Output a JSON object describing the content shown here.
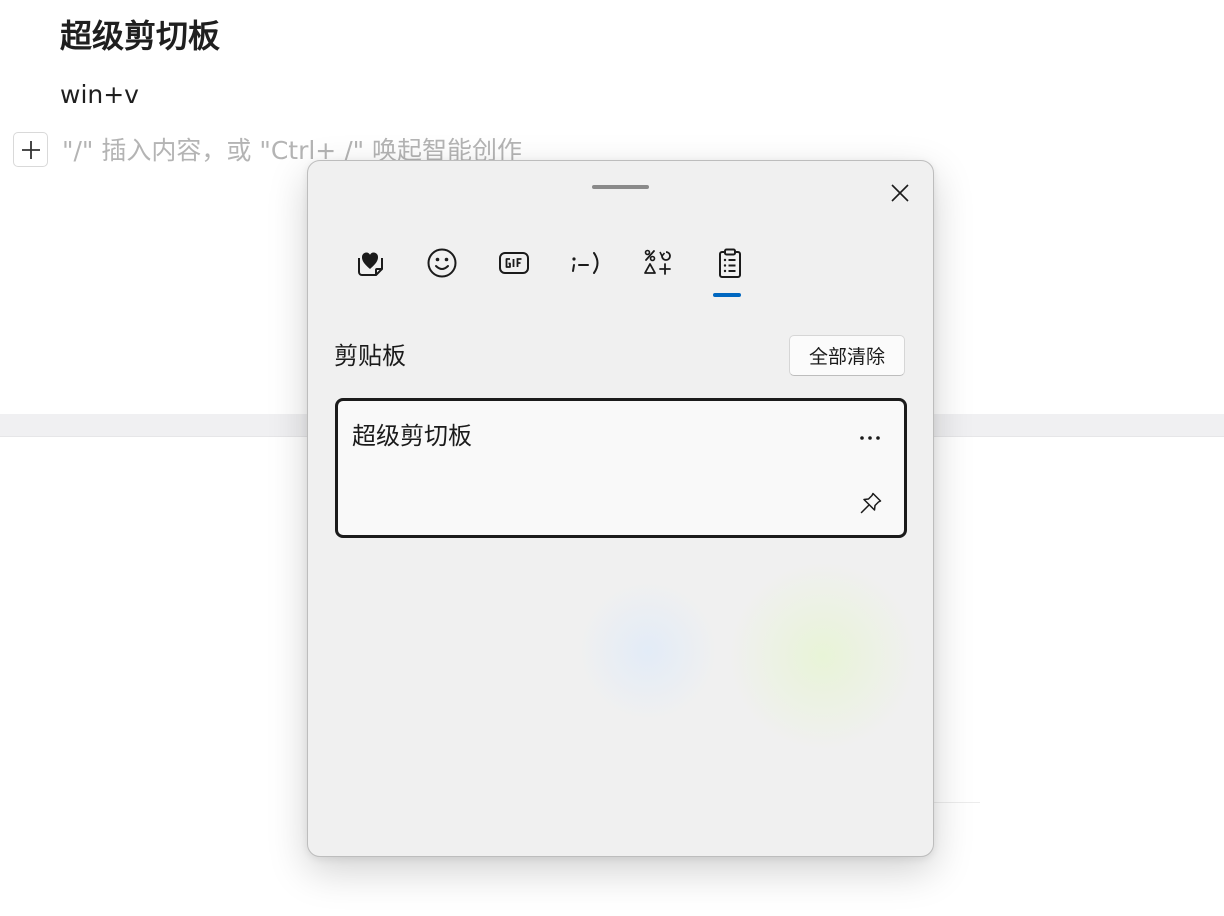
{
  "document": {
    "title": "超级剪切板",
    "line": "win+v",
    "placeholder": "\"/\" 插入内容，或 \"Ctrl+ /\" 唤起智能创作",
    "add_icon": "plus-icon"
  },
  "clipboard_panel": {
    "close_icon": "close-icon",
    "tabs": [
      {
        "icon": "heart-sticker-icon",
        "selected": false
      },
      {
        "icon": "smiley-icon",
        "selected": false
      },
      {
        "icon": "gif-icon",
        "selected": false
      },
      {
        "icon": "kaomoji-icon",
        "label": ";-)",
        "selected": false
      },
      {
        "icon": "symbols-icon",
        "selected": false
      },
      {
        "icon": "clipboard-icon",
        "selected": true
      }
    ],
    "accent_color": "#0067c0",
    "section_title": "剪贴板",
    "clear_all_label": "全部清除",
    "items": [
      {
        "text": "超级剪切板",
        "more_icon": "more-icon",
        "pin_icon": "pin-icon"
      }
    ]
  }
}
